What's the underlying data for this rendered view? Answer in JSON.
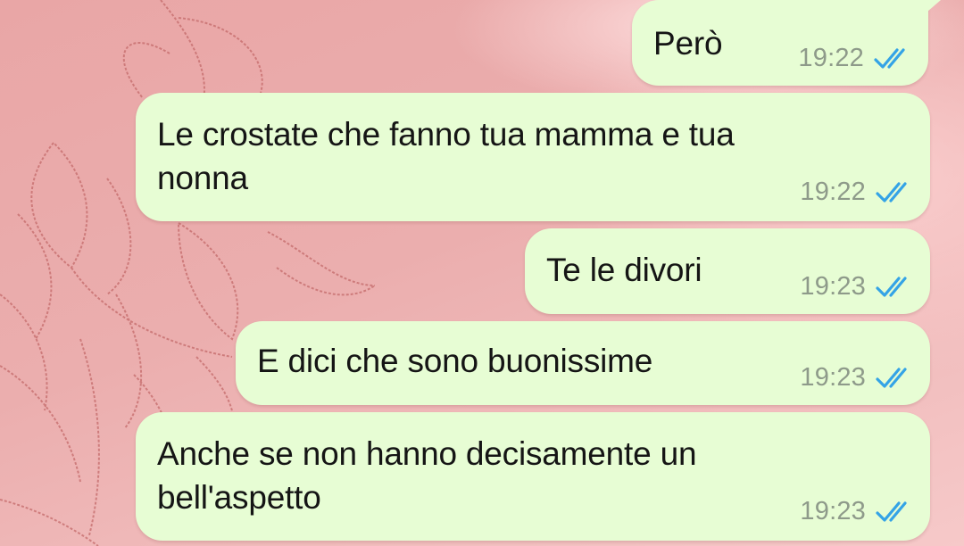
{
  "theme": {
    "bubble_color": "#e7fdd4",
    "time_color": "#8e9a8a",
    "tick_color": "#34a3e6",
    "wallpaper_color": "#e8a9a9"
  },
  "messages": [
    {
      "text": "Però",
      "time": "19:22",
      "status": "read-double-check-icon"
    },
    {
      "text": "Le crostate che fanno tua mamma e tua\nnonna",
      "time": "19:22",
      "status": "read-double-check-icon"
    },
    {
      "text": "Te le divori",
      "time": "19:23",
      "status": "read-double-check-icon"
    },
    {
      "text": "E dici che sono buonissime",
      "time": "19:23",
      "status": "read-double-check-icon"
    },
    {
      "text": "Anche se non hanno decisamente un\nbell'aspetto",
      "time": "19:23",
      "status": "read-double-check-icon"
    }
  ]
}
